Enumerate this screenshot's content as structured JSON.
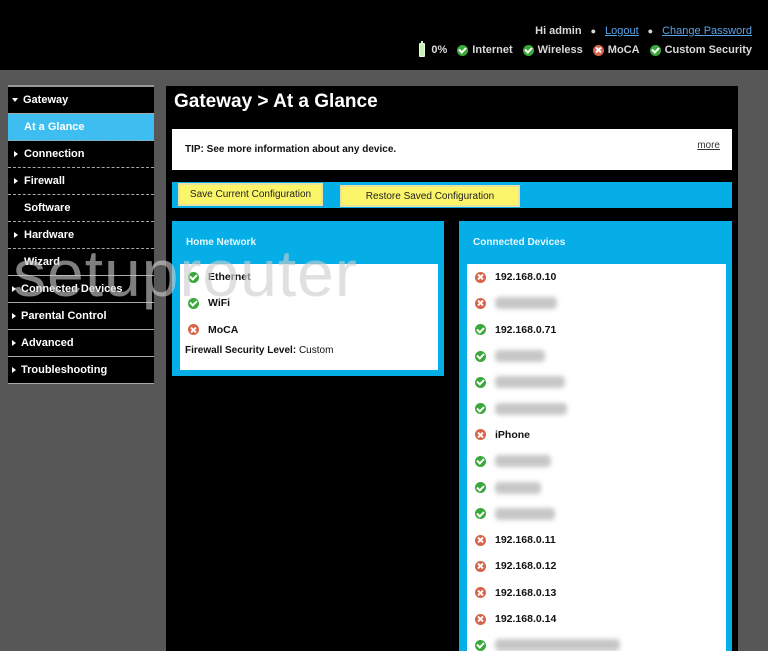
{
  "header": {
    "greeting": "Hi admin",
    "logout_label": "Logout",
    "change_password_label": "Change Password",
    "status": {
      "battery_percent": "0%",
      "items": [
        {
          "label": "Internet",
          "state": "ok"
        },
        {
          "label": "Wireless",
          "state": "ok"
        },
        {
          "label": "MoCA",
          "state": "error"
        },
        {
          "label": "Custom Security",
          "state": "ok"
        }
      ]
    }
  },
  "sidebar": {
    "items": [
      {
        "label": "Gateway",
        "level": 0,
        "expander": "expanded"
      },
      {
        "label": "At a Glance",
        "level": 1,
        "active": true
      },
      {
        "label": "Connection",
        "level": 1,
        "expander": "collapsed"
      },
      {
        "label": "Firewall",
        "level": 1,
        "expander": "collapsed"
      },
      {
        "label": "Software",
        "level": 1
      },
      {
        "label": "Hardware",
        "level": 1,
        "expander": "collapsed"
      },
      {
        "label": "Wizard",
        "level": 1
      },
      {
        "label": "Connected Devices",
        "level": 0,
        "expander": "collapsed"
      },
      {
        "label": "Parental Control",
        "level": 0,
        "expander": "collapsed"
      },
      {
        "label": "Advanced",
        "level": 0,
        "expander": "collapsed"
      },
      {
        "label": "Troubleshooting",
        "level": 0,
        "expander": "collapsed"
      }
    ]
  },
  "main": {
    "title": "Gateway > At a Glance",
    "tip": "TIP: See more information about any device.",
    "more_label": "more",
    "save_button": "Save Current Configuration",
    "restore_button": "Restore Saved Configuration",
    "home_network": {
      "title": "Home Network",
      "items": [
        {
          "label": "Ethernet",
          "state": "ok"
        },
        {
          "label": "WiFi",
          "state": "ok"
        },
        {
          "label": "MoCA",
          "state": "error"
        }
      ],
      "firewall_label": "Firewall Security Level:",
      "firewall_value": "Custom"
    },
    "connected_devices": {
      "title": "Connected Devices",
      "items": [
        {
          "label": "192.168.0.10",
          "state": "error"
        },
        {
          "label": "",
          "state": "error",
          "blurred": true
        },
        {
          "label": "192.168.0.71",
          "state": "ok"
        },
        {
          "label": "",
          "state": "ok",
          "blurred": true
        },
        {
          "label": "",
          "state": "ok",
          "blurred": true
        },
        {
          "label": "",
          "state": "ok",
          "blurred": true
        },
        {
          "label": "iPhone",
          "state": "error"
        },
        {
          "label": "",
          "state": "ok",
          "blurred": true
        },
        {
          "label": "",
          "state": "ok",
          "blurred": true
        },
        {
          "label": "",
          "state": "ok",
          "blurred": true
        },
        {
          "label": "192.168.0.11",
          "state": "error"
        },
        {
          "label": "192.168.0.12",
          "state": "error"
        },
        {
          "label": "192.168.0.13",
          "state": "error"
        },
        {
          "label": "192.168.0.14",
          "state": "error"
        },
        {
          "label": "",
          "state": "ok",
          "blurred": true
        }
      ]
    }
  },
  "watermark": "setuprouter",
  "colors": {
    "accent_blue": "#06aee8",
    "active_nav": "#3dbdf0",
    "button_yellow": "#fbf56a",
    "ok_green": "#3aa83a",
    "error_red": "#d7634a"
  }
}
